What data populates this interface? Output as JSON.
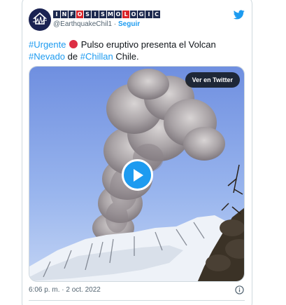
{
  "author": {
    "brand_letters": [
      "I",
      "N",
      "F",
      "O",
      "S",
      "I",
      "S",
      "M",
      "O",
      "L",
      "O",
      "G",
      "I",
      "C"
    ],
    "brand_red_indexes": [
      3,
      9
    ],
    "handle": "@EarthquakeChil1",
    "separator": "·",
    "follow_label": "Seguir"
  },
  "tweet": {
    "tag_urgente": "#Urgente",
    "text_1": " Pulso eruptivo presenta el Volcan ",
    "tag_nevado": "#Nevado",
    "text_2": " de ",
    "tag_chillan": "#Chillan",
    "text_3": " Chile."
  },
  "media": {
    "view_on_twitter_label": "Ver en Twitter"
  },
  "footer": {
    "timestamp": "6:06 p. m. · 2 oct. 2022"
  },
  "icons": {
    "logo": "twitter-bird-icon",
    "play": "play-icon",
    "info": "info-icon",
    "status": "red-circle-icon"
  },
  "colors": {
    "accent": "#1d9bf0",
    "brand_dark": "#1e2a4f",
    "brand_red": "#d9252a"
  }
}
